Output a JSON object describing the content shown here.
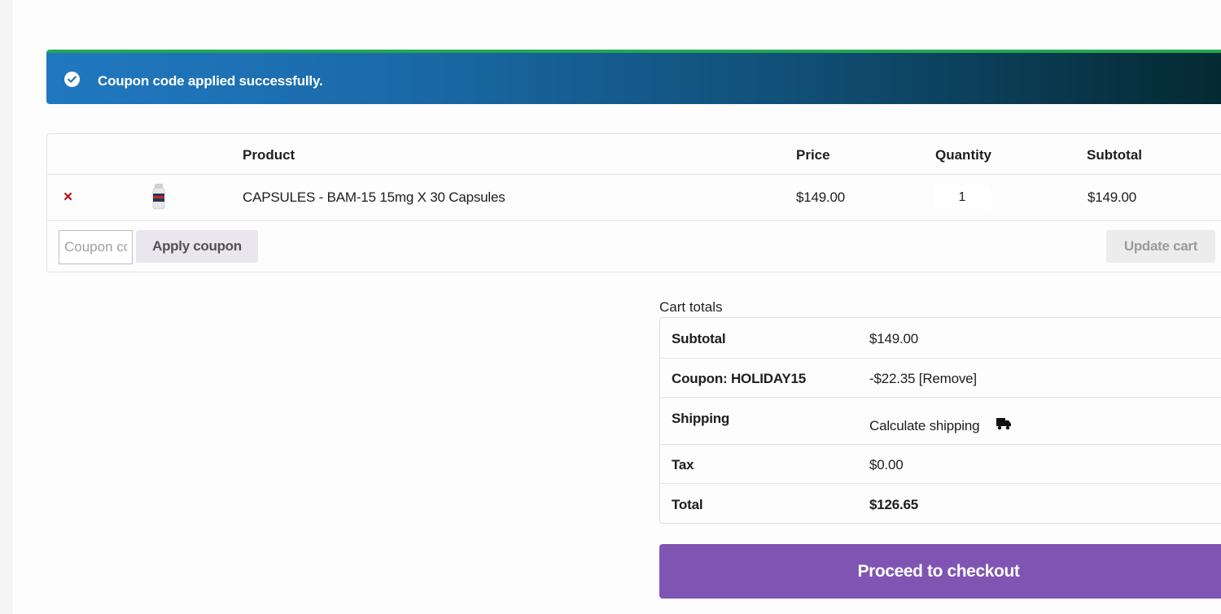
{
  "notice": {
    "message": "Coupon code applied successfully.",
    "icon": "check-circle-icon",
    "accent_color": "#21a94f"
  },
  "cart": {
    "headers": {
      "product": "Product",
      "price": "Price",
      "quantity": "Quantity",
      "subtotal": "Subtotal"
    },
    "items": [
      {
        "remove_glyph": "×",
        "name": "CAPSULES - BAM-15 15mg X 30 Capsules",
        "price": "$149.00",
        "quantity": "1",
        "subtotal": "$149.00"
      }
    ],
    "coupon_placeholder": "Coupon code",
    "apply_coupon_label": "Apply coupon",
    "update_cart_label": "Update cart"
  },
  "totals": {
    "title": "Cart totals",
    "subtotal_label": "Subtotal",
    "subtotal_value": "$149.00",
    "coupon_label": "Coupon: HOLIDAY15",
    "coupon_value": "-$22.35",
    "coupon_remove": "[Remove]",
    "shipping_label": "Shipping",
    "shipping_value": "Calculate shipping",
    "tax_label": "Tax",
    "tax_value": "$0.00",
    "total_label": "Total",
    "total_value": "$126.65"
  },
  "checkout": {
    "label": "Proceed to checkout",
    "color": "#7f54b3"
  }
}
